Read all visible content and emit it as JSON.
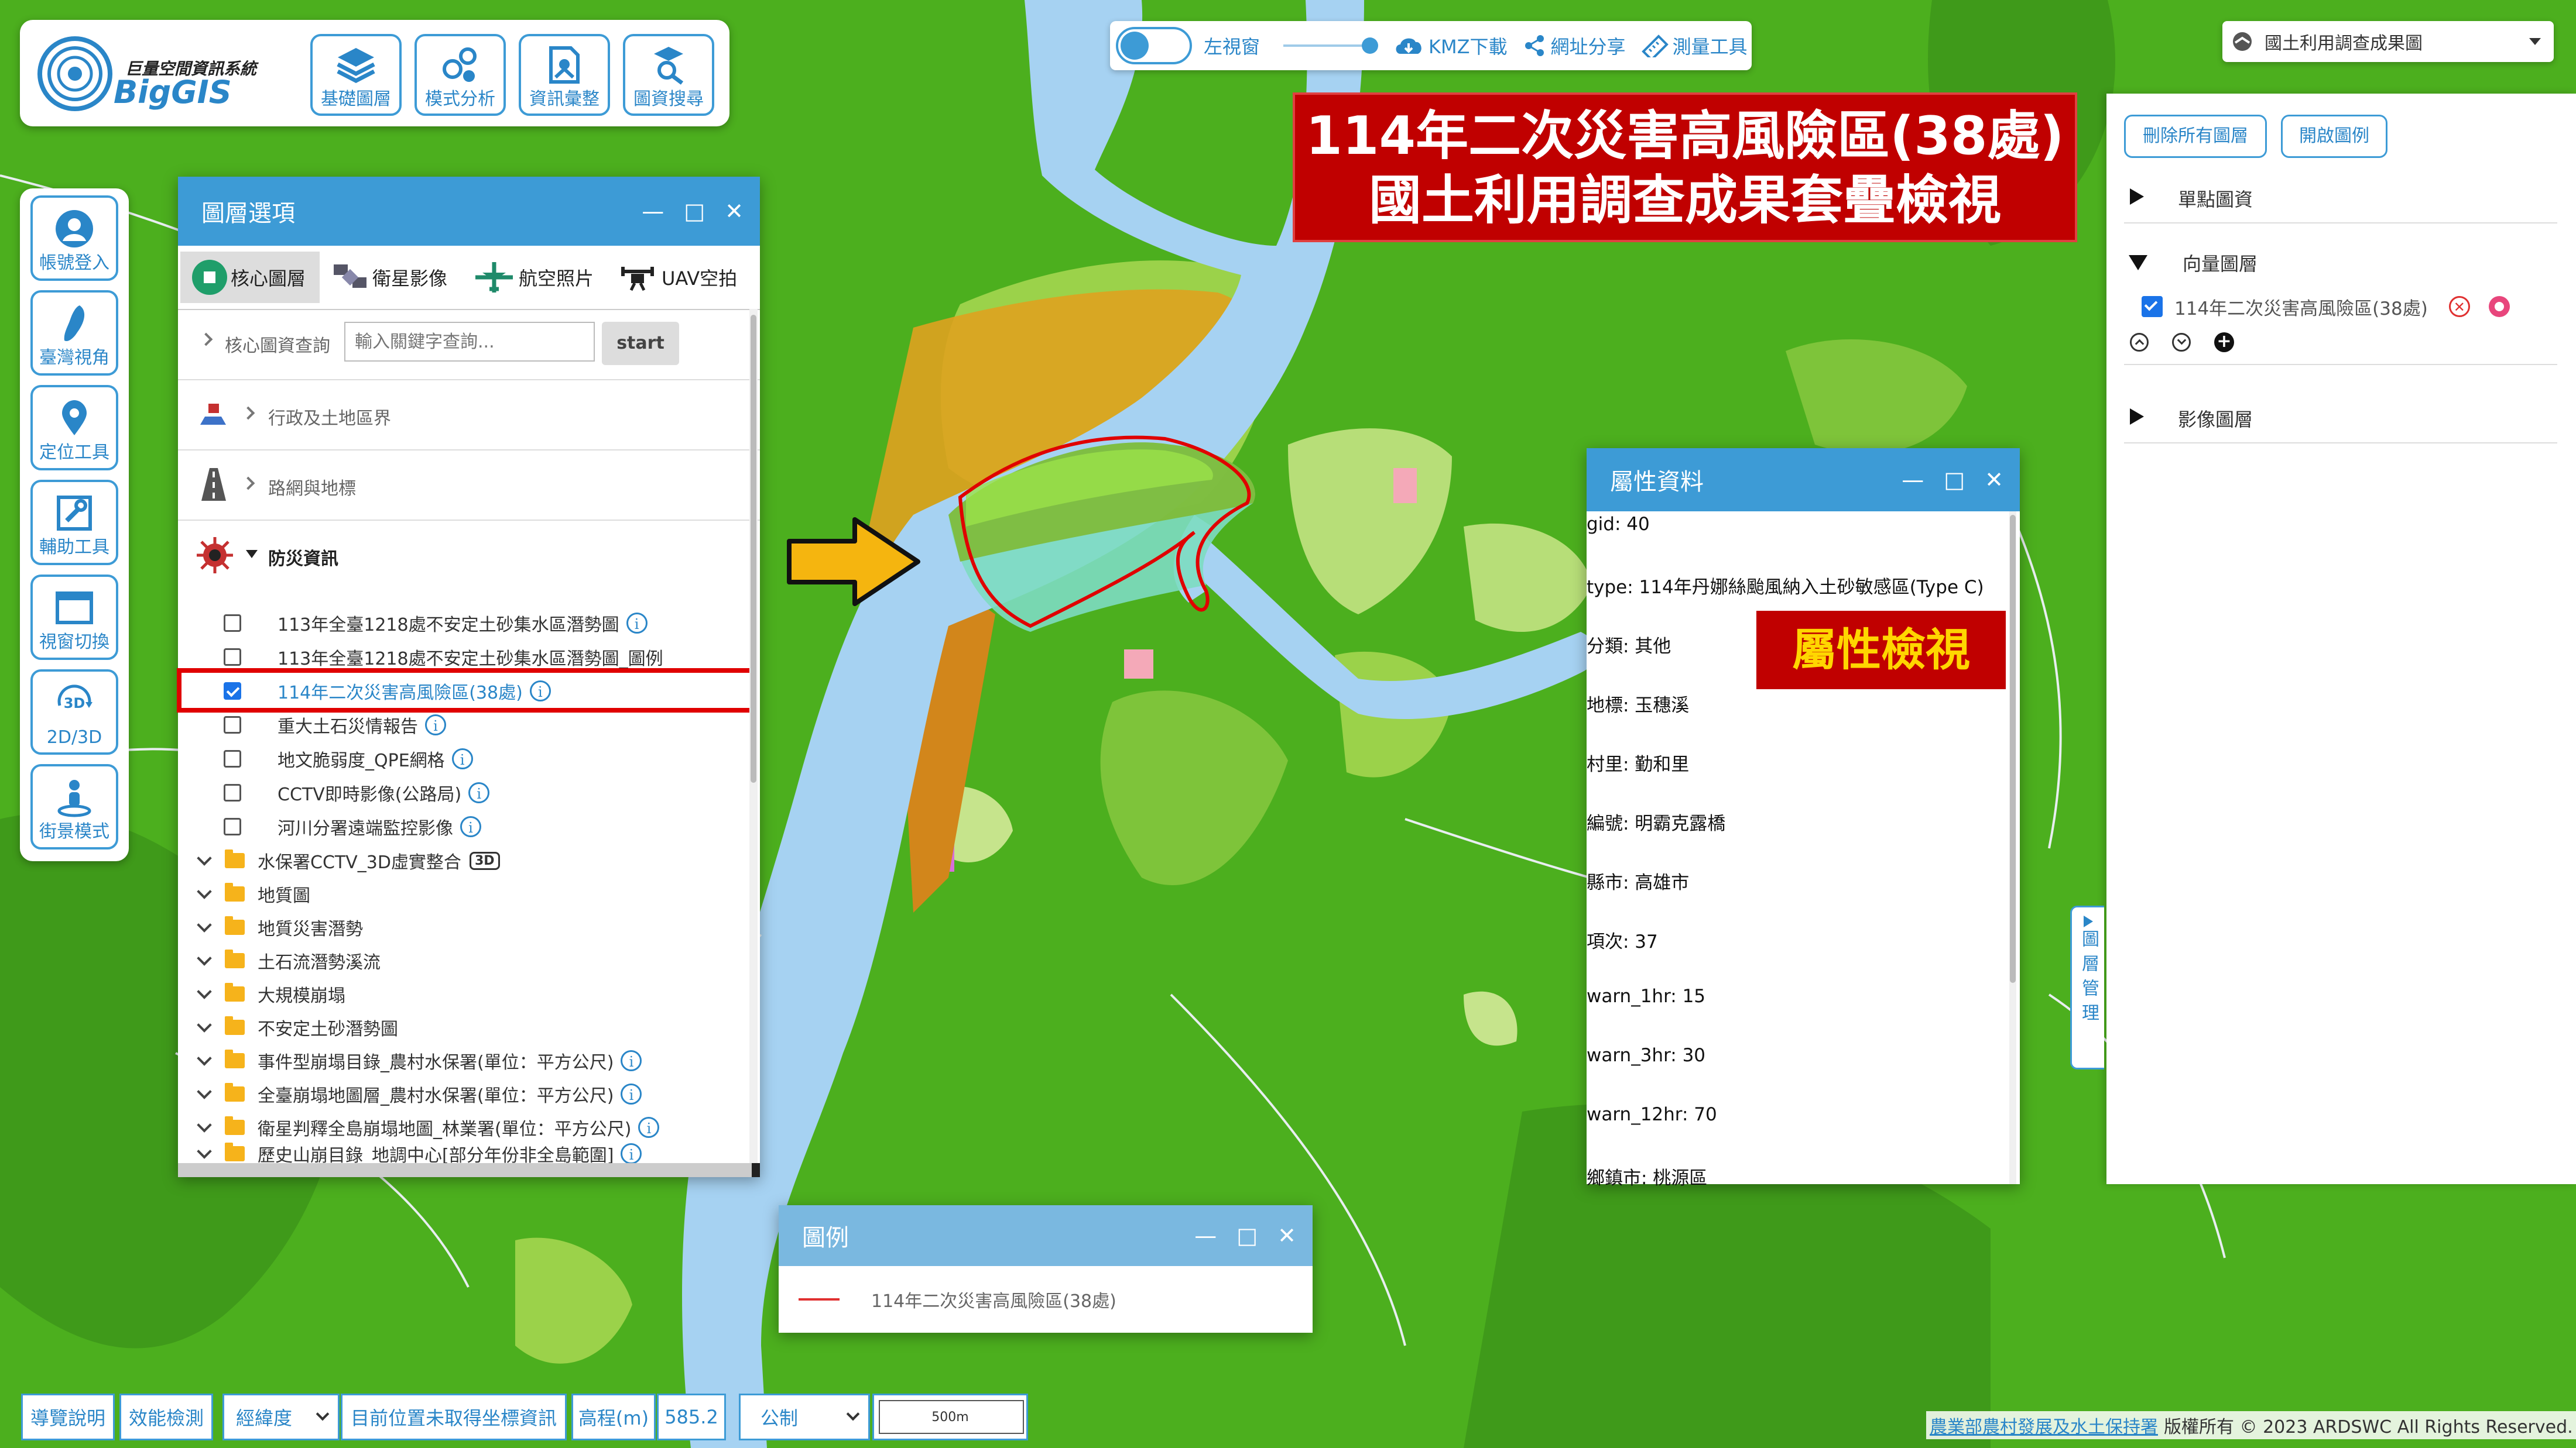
{
  "app": {
    "logo_text": "BigGIS",
    "logo_subtitle": "巨量空間資訊系統",
    "top_tools": [
      {
        "label": "基礎圖層",
        "icon": "layers-icon"
      },
      {
        "label": "模式分析",
        "icon": "model-icon"
      },
      {
        "label": "資訊彙整",
        "icon": "info-summary-icon"
      },
      {
        "label": "圖資搜尋",
        "icon": "map-search-icon"
      }
    ],
    "center_bar": {
      "left_view": "左視窗",
      "kmz": "KMZ下載",
      "share": "網址分享",
      "measure": "測量工具"
    },
    "basemap_select": "國土利用調查成果圖"
  },
  "side_tools": [
    {
      "label": "帳號登入",
      "icon": "user-icon"
    },
    {
      "label": "臺灣視角",
      "icon": "taiwan-icon"
    },
    {
      "label": "定位工具",
      "icon": "location-pin-icon"
    },
    {
      "label": "輔助工具",
      "icon": "tool-icon"
    },
    {
      "label": "視窗切換",
      "icon": "window-icon"
    },
    {
      "label": "2D/3D",
      "icon": "3d-icon"
    },
    {
      "label": "街景模式",
      "icon": "streetview-icon"
    }
  ],
  "layer_panel": {
    "title": "圖層選項",
    "tabs": [
      {
        "label": "核心圖層"
      },
      {
        "label": "衛星影像"
      },
      {
        "label": "航空照片"
      },
      {
        "label": "UAV空拍"
      }
    ],
    "search_label": "核心圖資查詢",
    "search_placeholder": "輸入關鍵字查詢...",
    "search_button": "start",
    "sections": [
      "行政及土地區界",
      "路網與地標",
      "防災資訊"
    ],
    "items": [
      {
        "label": "113年全臺1218處不安定土砂集水區潛勢圖",
        "checked": false,
        "info": true
      },
      {
        "label": "113年全臺1218處不安定土砂集水區潛勢圖_圖例",
        "checked": false,
        "info": false
      },
      {
        "label": "114年二次災害高風險區(38處)",
        "checked": true,
        "info": true
      },
      {
        "label": "重大土石災情報告",
        "checked": false,
        "info": true
      },
      {
        "label": "地文脆弱度_QPE網格",
        "checked": false,
        "info": true
      },
      {
        "label": "CCTV即時影像(公路局)",
        "checked": false,
        "info": true
      },
      {
        "label": "河川分署遠端監控影像",
        "checked": false,
        "info": true
      }
    ],
    "folders": [
      {
        "label": "水保署CCTV_3D虛實整合",
        "badge": "3D",
        "info": false
      },
      {
        "label": "地質圖",
        "info": false
      },
      {
        "label": "地質災害潛勢",
        "info": false
      },
      {
        "label": "土石流潛勢溪流",
        "info": false
      },
      {
        "label": "大規模崩塌",
        "info": false
      },
      {
        "label": "不安定土砂潛勢圖",
        "info": false
      },
      {
        "label": "事件型崩塌目錄_農村水保署(單位：平方公尺)",
        "info": true
      },
      {
        "label": "全臺崩塌地圖層_農村水保署(單位：平方公尺)",
        "info": true
      },
      {
        "label": "衛星判釋全島崩塌地圖_林業署(單位：平方公尺)",
        "info": true
      },
      {
        "label": "歷史山崩目錄_地調中心[部分年份非全島範圍]",
        "info": true
      }
    ]
  },
  "title_banner": {
    "line1": "114年二次災害高風險區(38處)",
    "line2": "國土利用調查成果套疊檢視"
  },
  "attr_panel": {
    "title": "屬性資料",
    "rows": [
      "gid: 40",
      "type: 114年丹娜絲颱風納入土砂敏感區(Type C)",
      "分類: 其他",
      "地標: 玉穗溪",
      "村里: 勤和里",
      "編號: 明霸克露橋",
      "縣市: 高雄市",
      "項次: 37",
      "warn_1hr: 15",
      "warn_3hr: 30",
      "warn_12hr: 70",
      "鄉鎮市: 桃源區"
    ],
    "callout": "屬性檢視"
  },
  "right_panel": {
    "remove_all": "刪除所有圖層",
    "open_legend": "開啟圖例",
    "groups": [
      "單點圖資",
      "向量圖層",
      "影像圖層"
    ],
    "active_layer": "114年二次災害高風險區(38處)",
    "side_tab": "圖層管理"
  },
  "legend_panel": {
    "title": "圖例",
    "item": "114年二次災害高風險區(38處)"
  },
  "bottom_bar": {
    "guide": "導覽說明",
    "perf": "效能檢測",
    "coord_type": "經緯度",
    "coord_value": "目前位置未取得坐標資訊",
    "elev_label": "高程(m)",
    "elev_value": "585.2",
    "unit": "公制",
    "scale": "500m",
    "copyright_org": "農業部農村發展及水土保持署",
    "copyright": "版權所有 © 2023 ARDSWC All Rights Reserved."
  },
  "colors": {
    "accent": "#3d9bd6",
    "highlight_red": "#e00000",
    "banner_bg": "#c00000",
    "callout_text": "#ffd600",
    "arrow": "#f5b50f",
    "river": "#a6d2f2",
    "forest": "#4caf1e"
  }
}
